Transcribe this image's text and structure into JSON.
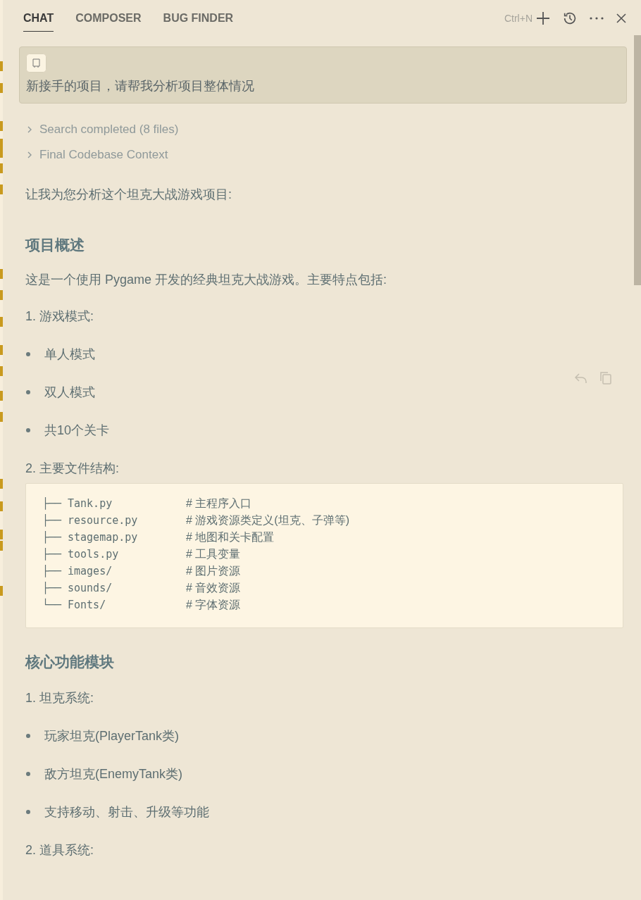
{
  "tabs": [
    {
      "label": "CHAT",
      "selected": true
    },
    {
      "label": "COMPOSER",
      "selected": false
    },
    {
      "label": "BUG FINDER",
      "selected": false
    }
  ],
  "shortcut": "Ctrl+N",
  "user_message": "新接手的项目，请帮我分析项目整体情况",
  "steps": [
    {
      "label": "Search completed (8 files)",
      "expanded": false
    },
    {
      "label": "Final Codebase Context",
      "expanded": false
    }
  ],
  "blocks": [
    {
      "kind": "paragraph",
      "text": "让我为您分析这个坦克大战游戏项目:"
    },
    {
      "kind": "heading",
      "text": "项目概述"
    },
    {
      "kind": "paragraph",
      "text": "这是一个使用 Pygame 开发的经典坦克大战游戏。主要特点包括:"
    },
    {
      "kind": "numbered",
      "text": "1. 游戏模式:"
    },
    {
      "kind": "bullet",
      "text": "单人模式"
    },
    {
      "kind": "bullet",
      "text": "双人模式"
    },
    {
      "kind": "bullet",
      "text": "共10个关卡"
    },
    {
      "kind": "numbered",
      "text": "2. 主要文件结构:"
    },
    {
      "kind": "code",
      "lines": [
        {
          "tree": "├──",
          "name": "Tank.py",
          "comment": "# 主程序入口"
        },
        {
          "tree": "├──",
          "name": "resource.py",
          "comment": "# 游戏资源类定义(坦克、子弹等)"
        },
        {
          "tree": "├──",
          "name": "stagemap.py",
          "comment": "# 地图和关卡配置"
        },
        {
          "tree": "├──",
          "name": "tools.py",
          "comment": "# 工具变量"
        },
        {
          "tree": "├──",
          "name": "images/",
          "comment": "# 图片资源"
        },
        {
          "tree": "├──",
          "name": "sounds/",
          "comment": "# 音效资源"
        },
        {
          "tree": "└──",
          "name": "Fonts/",
          "comment": "# 字体资源"
        }
      ]
    },
    {
      "kind": "heading",
      "text": "核心功能模块"
    },
    {
      "kind": "numbered",
      "text": "1. 坦克系统:"
    },
    {
      "kind": "bullet",
      "text": "玩家坦克(PlayerTank类)"
    },
    {
      "kind": "bullet",
      "text": "敌方坦克(EnemyTank类)"
    },
    {
      "kind": "bullet",
      "text": "支持移动、射击、升级等功能"
    },
    {
      "kind": "numbered",
      "text": "2. 道具系统:"
    }
  ]
}
